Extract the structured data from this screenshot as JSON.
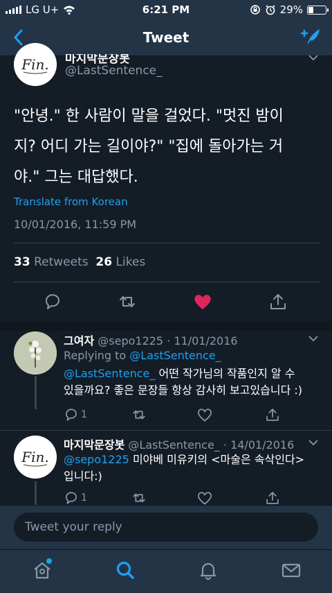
{
  "status_bar": {
    "carrier": "LG U+",
    "time": "6:21 PM",
    "battery": "29%",
    "battery_level": 0.29
  },
  "nav": {
    "title": "Tweet"
  },
  "main_tweet": {
    "name": "마지막문장봇",
    "handle": "@LastSentence_",
    "lines": [
      "\"안녕.\" 한 사람이 말을 걸었다. \"멋진 밤이",
      "지? 어디 가는 길이야?\" \"집에 돌아가는 거",
      "야.\" 그는 대답했다."
    ],
    "translate": "Translate from Korean",
    "timestamp": "10/01/2016, 11:59 PM",
    "retweets": "33",
    "retweets_label": "Retweets",
    "likes": "26",
    "likes_label": "Likes"
  },
  "replies": [
    {
      "name": "그여자",
      "handle": "@sepo1225",
      "date": "11/01/2016",
      "replying_to_label": "Replying to",
      "replying_to": "@LastSentence_",
      "mention": "@LastSentence_",
      "text_1": "어떤 작가님의 작품인지 알 수",
      "text_2": "있을까요? 좋은 문장들 항상 감사히 보고있습니다 :)",
      "reply_count": "1"
    },
    {
      "name": "마지막문장봇",
      "handle": "@LastSentence_",
      "date": "14/01/2016",
      "mention": "@sepo1225",
      "text_1": "미야베 미유키의 <마술은 속삭인다>",
      "text_2": "입니다:)",
      "reply_count": "1"
    }
  ],
  "avatar_text": "Fin.",
  "reply_box": {
    "placeholder": "Tweet your reply"
  },
  "colors": {
    "background": "#141d26",
    "bar": "#243447",
    "accent": "#1da1f2",
    "like": "#e0245e",
    "muted": "#8899a6"
  },
  "icons": [
    "back-arrow-icon",
    "compose-icon",
    "reply-icon",
    "retweet-icon",
    "heart-icon",
    "share-icon",
    "home-icon",
    "search-icon",
    "bell-icon",
    "mail-icon",
    "chevron-down-icon"
  ]
}
